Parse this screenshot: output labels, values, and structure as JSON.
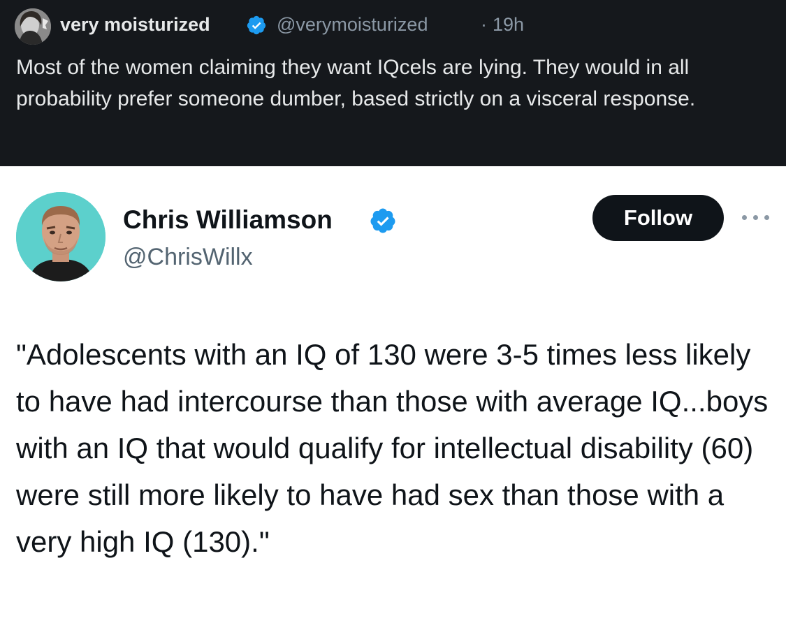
{
  "quoted_tweet": {
    "display_name": "very moisturized",
    "handle": "@verymoisturized",
    "separator": "·",
    "timestamp": "19h",
    "text": "Most of the women claiming they want IQcels are lying. They would in all probability prefer someone dumber, based strictly on a visceral response."
  },
  "tweet": {
    "display_name": "Chris Williamson",
    "handle": "@ChrisWillx",
    "follow_label": "Follow",
    "text": "\"Adolescents with an IQ of 130 were 3-5 times less likely to have had intercourse than those with average IQ...boys with an IQ that would qualify for intellectual disability (60) were still more likely to have had sex than those with a very high IQ (130).\""
  },
  "icons": {
    "verified": "verified-badge-icon",
    "more": "more-options-icon"
  },
  "colors": {
    "header_bg": "#15181c",
    "header_text": "#e7e9ea",
    "muted_text": "#8b98a5",
    "verified_blue": "#1d9bf0",
    "follow_button_bg": "#0f1419",
    "body_text": "#0f1419",
    "handle_text": "#536471"
  }
}
